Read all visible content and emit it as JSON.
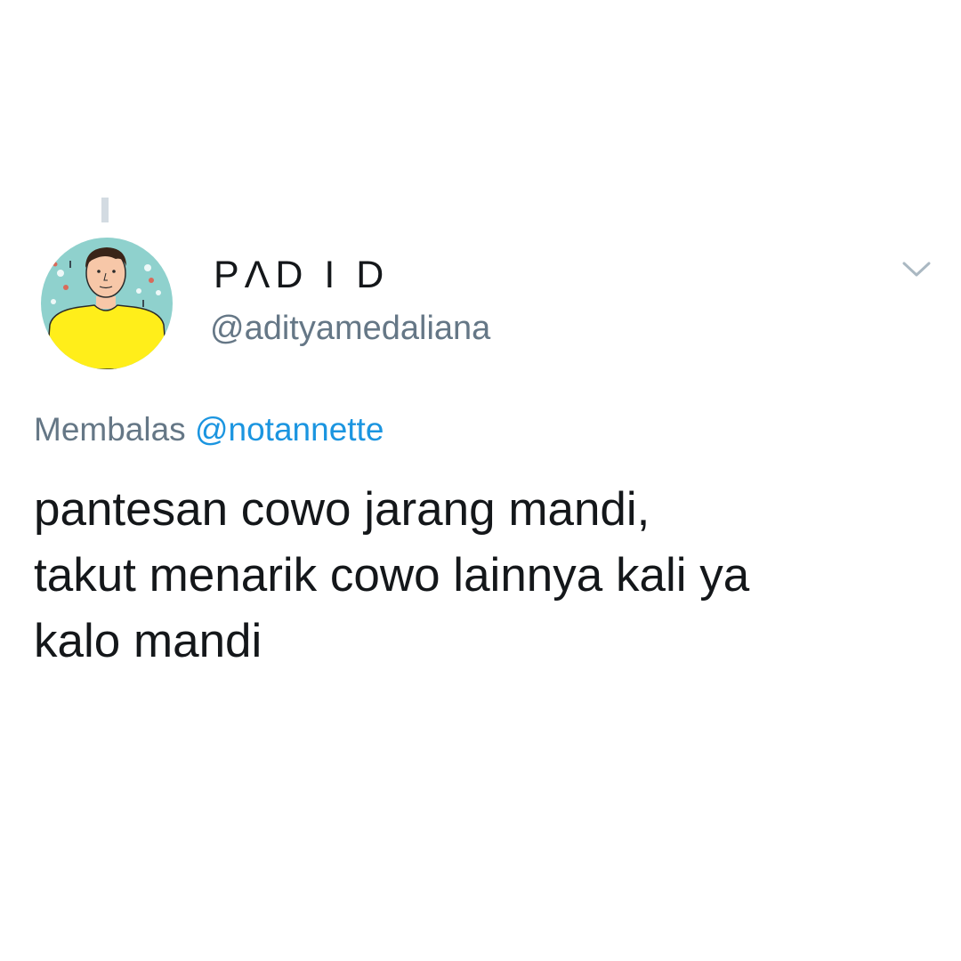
{
  "tweet": {
    "display_name": "PΛD I D",
    "handle": "@adityamedaliana",
    "reply_prefix": "Membalas",
    "reply_mention": "@notannette",
    "text_lines": [
      "pantesan cowo jarang mandi,",
      "takut menarik cowo lainnya kali ya",
      "kalo mandi"
    ]
  },
  "icons": {
    "menu": "chevron-down-icon",
    "avatar": "avatar"
  },
  "colors": {
    "text_primary": "#14171a",
    "text_secondary": "#657786",
    "link": "#1b95e0",
    "thread_line": "#d3dbe2",
    "avatar_bg": "#8fd1cd",
    "avatar_shirt": "#ffee1a"
  }
}
